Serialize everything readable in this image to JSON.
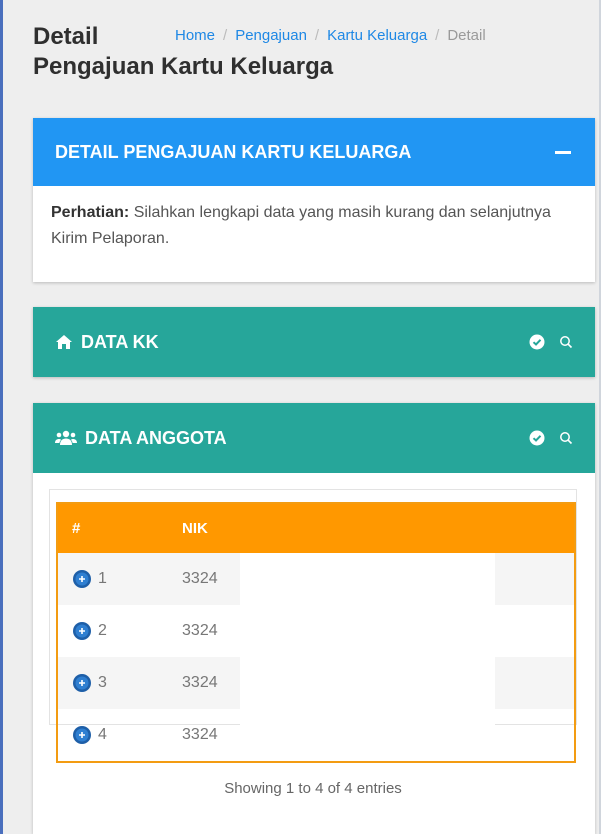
{
  "page": {
    "title_line1": "Detail",
    "title_line2": "Pengajuan Kartu Keluarga"
  },
  "breadcrumb": {
    "items": [
      "Home",
      "Pengajuan",
      "Kartu Keluarga"
    ],
    "current": "Detail"
  },
  "notice_card": {
    "title": "DETAIL PENGAJUAN KARTU KELUARGA",
    "note_label": "Perhatian:",
    "note_text": " Silahkan lengkapi data yang masih kurang dan selanjutnya Kirim Pelaporan.",
    "header_color": "#2196f3"
  },
  "data_kk_card": {
    "title": "DATA KK",
    "icon": "home-icon",
    "header_color": "#26a69a"
  },
  "data_anggota_card": {
    "title": "DATA ANGGOTA",
    "icon": "users-icon",
    "header_color": "#26a69a"
  },
  "table": {
    "header_color": "#ff9800",
    "columns": [
      "#",
      "NIK"
    ],
    "rows": [
      {
        "no": "1",
        "nik": "3324"
      },
      {
        "no": "2",
        "nik": "3324"
      },
      {
        "no": "3",
        "nik": "3324"
      },
      {
        "no": "4",
        "nik": "3324"
      }
    ],
    "info": "Showing 1 to 4 of 4 entries"
  }
}
